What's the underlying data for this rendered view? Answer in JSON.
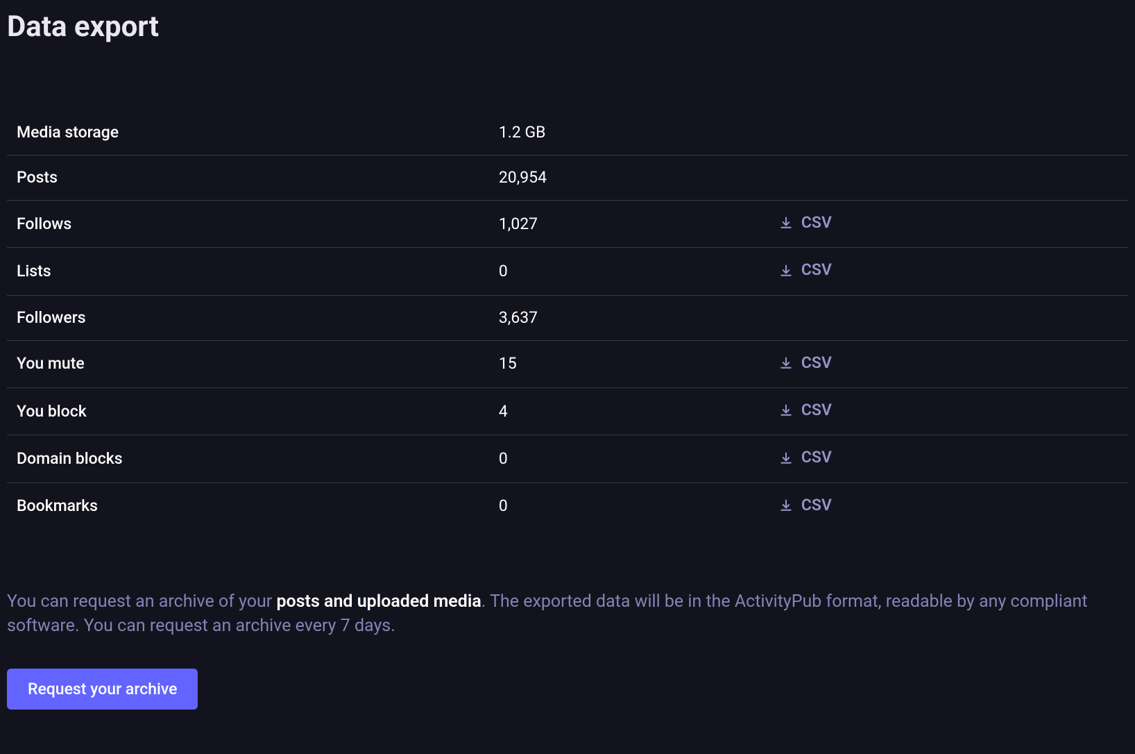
{
  "page": {
    "title": "Data export"
  },
  "rows": [
    {
      "label": "Media storage",
      "value": "1.2 GB",
      "csv": false
    },
    {
      "label": "Posts",
      "value": "20,954",
      "csv": false
    },
    {
      "label": "Follows",
      "value": "1,027",
      "csv": true
    },
    {
      "label": "Lists",
      "value": "0",
      "csv": true
    },
    {
      "label": "Followers",
      "value": "3,637",
      "csv": false
    },
    {
      "label": "You mute",
      "value": "15",
      "csv": true
    },
    {
      "label": "You block",
      "value": "4",
      "csv": true
    },
    {
      "label": "Domain blocks",
      "value": "0",
      "csv": true
    },
    {
      "label": "Bookmarks",
      "value": "0",
      "csv": true
    }
  ],
  "csv_label": "CSV",
  "description": {
    "prefix": "You can request an archive of your ",
    "strong": "posts and uploaded media",
    "suffix": ". The exported data will be in the ActivityPub format, readable by any compliant software. You can request an archive every 7 days."
  },
  "button": {
    "request_archive": "Request your archive"
  }
}
